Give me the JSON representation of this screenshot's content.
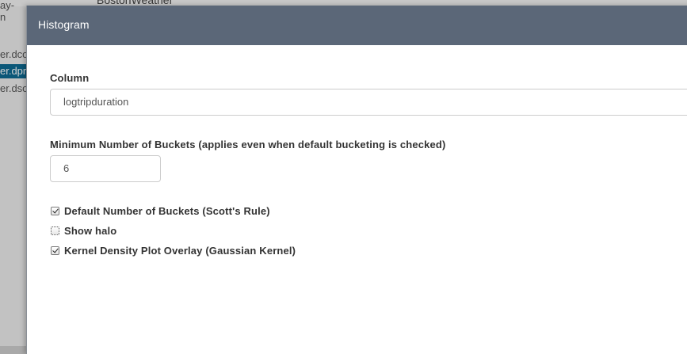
{
  "background": {
    "topbar_text": "BostonWeather",
    "left_items": [
      "ay-",
      "n",
      "er.dco",
      "er.dpre",
      "er.dso"
    ],
    "selected_item_index": 3
  },
  "dialog": {
    "title": "Histogram",
    "column": {
      "label": "Column",
      "value": "logtripduration"
    },
    "min_buckets": {
      "label": "Minimum Number of Buckets (applies even when default bucketing is checked)",
      "value": "6"
    },
    "options": [
      {
        "label": "Default Number of Buckets (Scott's Rule)",
        "checked": true
      },
      {
        "label": "Show halo",
        "checked": false
      },
      {
        "label": "Kernel Density Plot Overlay (Gaussian Kernel)",
        "checked": true
      }
    ]
  },
  "colors": {
    "header": "#5b6778",
    "selected": "#0e6b93"
  }
}
